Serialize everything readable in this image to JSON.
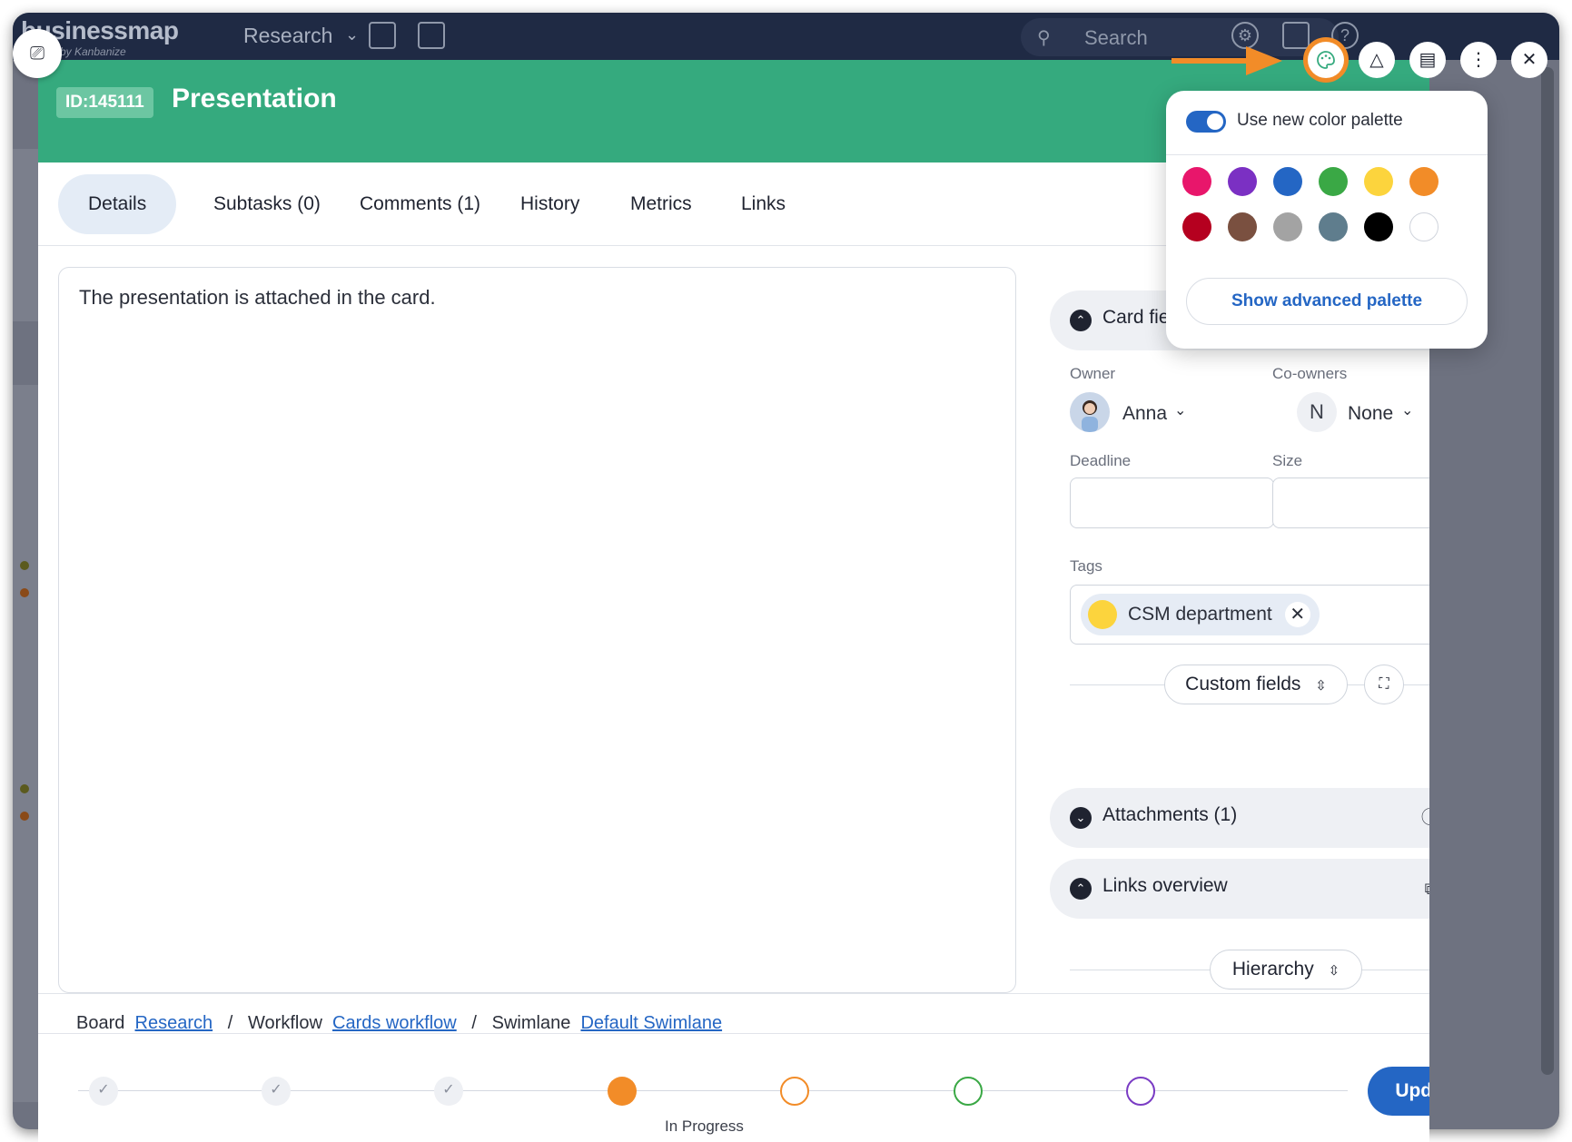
{
  "appbar": {
    "logo": "businessmap",
    "sublogo": "by Kanbanize",
    "board_selector": "Research",
    "search_placeholder": "Search"
  },
  "card": {
    "id_label": "ID:145111",
    "title": "Presentation",
    "header_color": "#35aa7e"
  },
  "tabs": [
    {
      "label": "Details",
      "active": true
    },
    {
      "label": "Subtasks (0)"
    },
    {
      "label": "Comments (1)"
    },
    {
      "label": "History"
    },
    {
      "label": "Metrics"
    },
    {
      "label": "Links"
    }
  ],
  "description": "The presentation is attached in the card.",
  "card_fields": {
    "section_label": "Card field",
    "owner_label": "Owner",
    "owner_name": "Anna",
    "coowners_label": "Co-owners",
    "coowner_initial": "N",
    "coowner_value": "None",
    "deadline_label": "Deadline",
    "size_label": "Size",
    "tags_label": "Tags",
    "tag_name": "CSM department",
    "tag_color": "#fcd43d",
    "custom_fields_label": "Custom fields"
  },
  "attachments": {
    "label": "Attachments (1)"
  },
  "links_overview": {
    "label": "Links overview"
  },
  "hierarchy": {
    "label": "Hierarchy"
  },
  "breadcrumb": {
    "board_prefix": "Board",
    "board_link": "Research",
    "sep1": "/",
    "workflow_prefix": "Workflow",
    "workflow_link": "Cards workflow",
    "sep2": "/",
    "swimlane_prefix": "Swimlane",
    "swimlane_link": "Default Swimlane"
  },
  "workflow_steps": [
    {
      "state": "done",
      "color": "#c8ccd4"
    },
    {
      "state": "done",
      "color": "#c8ccd4"
    },
    {
      "state": "done",
      "color": "#c8ccd4"
    },
    {
      "state": "current",
      "color": "#f28c28"
    },
    {
      "state": "future",
      "color": "#f28c28"
    },
    {
      "state": "future",
      "color": "#3aa845"
    },
    {
      "state": "future",
      "color": "#7a3cc4"
    }
  ],
  "current_step_label": "In Progress",
  "update_button": "Update card",
  "color_popover": {
    "toggle_label": "Use new color palette",
    "toggle_on": true,
    "swatches_row1": [
      "#e8166b",
      "#7b30c3",
      "#2466c4",
      "#3aa845",
      "#fcd43d",
      "#f28c28"
    ],
    "swatches_row2": [
      "#b5001f",
      "#7a5040",
      "#a3a3a3",
      "#5f7d8d",
      "#000000",
      "#ffffff"
    ],
    "advanced_button": "Show advanced palette"
  },
  "annotation_arrow_color": "#f28c28"
}
